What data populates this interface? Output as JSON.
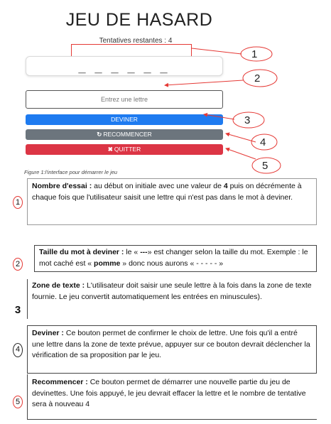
{
  "app": {
    "title": "JEU DE HASARD",
    "tries_label": "Tentatives restantes : 4",
    "hidden_word": "_ _ _ _ _ _",
    "input_placeholder": "Entrez une lettre",
    "buttons": {
      "guess": "DEVINER",
      "restart_icon": "refresh-icon",
      "restart": "RECOMMENCER",
      "quit_icon": "close-icon",
      "quit": "QUITTER"
    }
  },
  "callouts": [
    "1",
    "2",
    "3",
    "4",
    "5"
  ],
  "caption": "Figure 1:l'interface pour démarrer le jeu",
  "descriptions": [
    {
      "number": "1",
      "term": "Nombre d'essai :",
      "text_a": " au début on initiale avec une valeur de ",
      "value": "4",
      "text_b": " puis on décrémente à chaque fois que l'utilisateur saisit une lettre qui n'est pas dans le mot à deviner."
    },
    {
      "number": "2",
      "term": "Taille du mot à deviner :",
      "text_a": " le « ",
      "dashes": "---",
      "text_b": "» est changer selon la taille du mot. Exemple : le mot caché est « ",
      "example": "pomme",
      "text_c": " »  donc nous aurons « - - - - - »"
    },
    {
      "number": "3",
      "term": "Zone de texte :",
      "text": " L'utilisateur doit saisir une seule lettre à la fois dans la zone de texte fournie. Le jeu convertit automatiquement les entrées en minuscules)."
    },
    {
      "number": "4",
      "term": "Deviner :",
      "text": " Ce bouton permet de confirmer le choix de lettre. Une fois qu'il a entré une lettre dans la zone de texte prévue, appuyer sur ce bouton devrait déclencher la vérification de sa proposition par le jeu."
    },
    {
      "number": "5",
      "term": "Recommencer :",
      "text": " Ce bouton permet de démarrer une nouvelle partie du jeu de devinettes. Une fois appuyé, le jeu devrait effacer la lettre et le nombre de tentative sera à nouveau 4"
    }
  ],
  "colors": {
    "annotation_red": "#e53935",
    "guess_blue": "#1e7bf0",
    "restart_gray": "#6c757d",
    "quit_red": "#dc3545"
  }
}
